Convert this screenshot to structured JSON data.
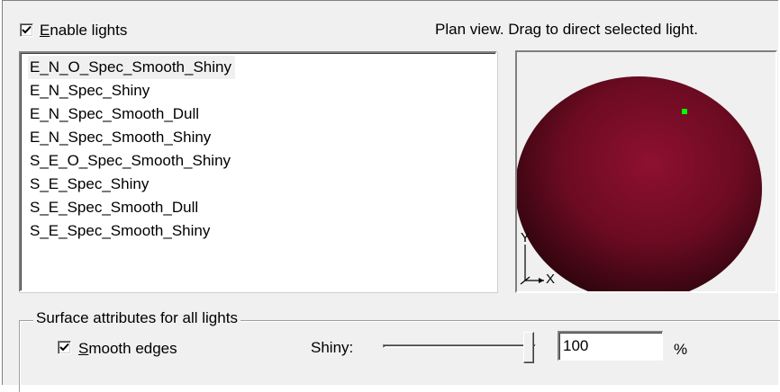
{
  "lights": {
    "enable_label_accel": "E",
    "enable_label_rest": "nable lights",
    "enable_checked": true,
    "plan_hint": "Plan view. Drag to direct selected light.",
    "presets": [
      "E_N_O_Spec_Smooth_Shiny",
      "E_N_Spec_Shiny",
      "E_N_Spec_Smooth_Dull",
      "E_N_Spec_Smooth_Shiny",
      "S_E_O_Spec_Smooth_Shiny",
      "S_E_Spec_Shiny",
      "S_E_Spec_Smooth_Dull",
      "S_E_Spec_Smooth_Shiny"
    ],
    "selected_preset": "E_N_O_Spec_Smooth_Shiny"
  },
  "preview": {
    "axis_y": "Y",
    "axis_x": "X",
    "sphere_color": "#8b1028",
    "light_color": "#00ff00"
  },
  "surface": {
    "group_title": "Surface attributes for all lights",
    "smooth_accel": "S",
    "smooth_rest": "mooth edges",
    "smooth_checked": true,
    "shiny_label": "Shiny:",
    "shiny_value": "100",
    "shiny_level": 1.0,
    "percent_sign": "%"
  }
}
